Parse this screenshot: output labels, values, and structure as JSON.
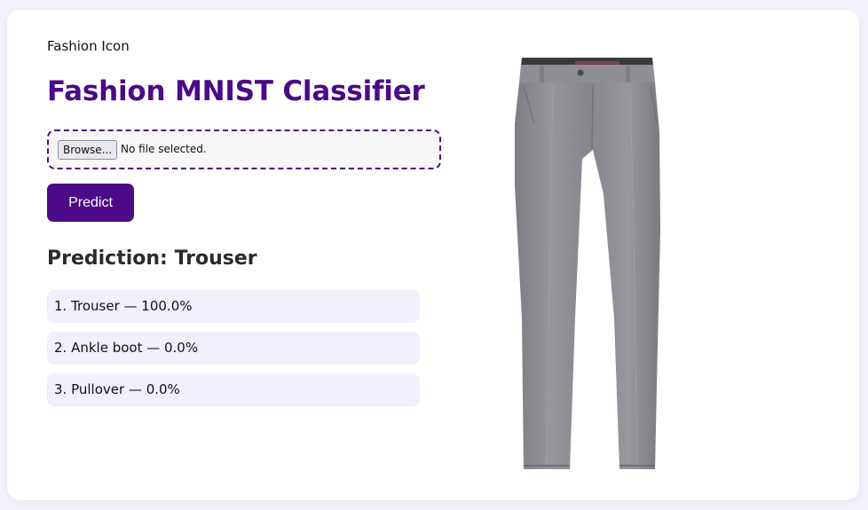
{
  "header": {
    "brand": "Fashion Icon",
    "title": "Fashion MNIST Classifier"
  },
  "upload": {
    "browse_label": "Browse...",
    "status": "No file selected."
  },
  "actions": {
    "predict_label": "Predict"
  },
  "prediction": {
    "heading": "Prediction: Trouser",
    "results": [
      "1. Trouser — 100.0%",
      "2. Ankle boot — 0.0%",
      "3. Pullover — 0.0%"
    ]
  },
  "preview": {
    "icon": "trouser-image"
  },
  "colors": {
    "accent": "#4b0a87",
    "result_bg": "#f0f0fc",
    "page_bg": "#f2f3fa",
    "trouser_gray": "#8b8b91"
  }
}
